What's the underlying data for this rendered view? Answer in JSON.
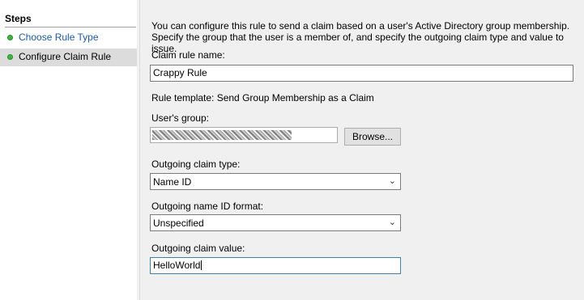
{
  "sidebar": {
    "title": "Steps",
    "items": [
      {
        "label": "Choose Rule Type",
        "status": "complete"
      },
      {
        "label": "Configure Claim Rule",
        "status": "current"
      }
    ]
  },
  "main": {
    "description": "You can configure this rule to send a claim based on a user's Active Directory group membership. Specify the group that the user is a member of, and specify the outgoing claim type and value to issue.",
    "claim_rule_name_label": "Claim rule name:",
    "claim_rule_name_value": "Crappy Rule",
    "rule_template": "Rule template: Send Group Membership as a Claim",
    "users_group_label": "User's group:",
    "browse_label": "Browse...",
    "outgoing_claim_type_label": "Outgoing claim type:",
    "outgoing_claim_type_value": "Name ID",
    "outgoing_name_id_format_label": "Outgoing name ID format:",
    "outgoing_name_id_format_value": "Unspecified",
    "outgoing_claim_value_label": "Outgoing claim value:",
    "outgoing_claim_value_value": "HelloWorld"
  },
  "colors": {
    "complete_dot": "#3cb93c",
    "link_text": "#1c5aa6",
    "selected_step_bg": "#dcdcdc",
    "focus_border": "#3c7fb1"
  },
  "icons": {
    "step_status": "green-circle-icon",
    "dropdown": "chevron-down-icon"
  }
}
